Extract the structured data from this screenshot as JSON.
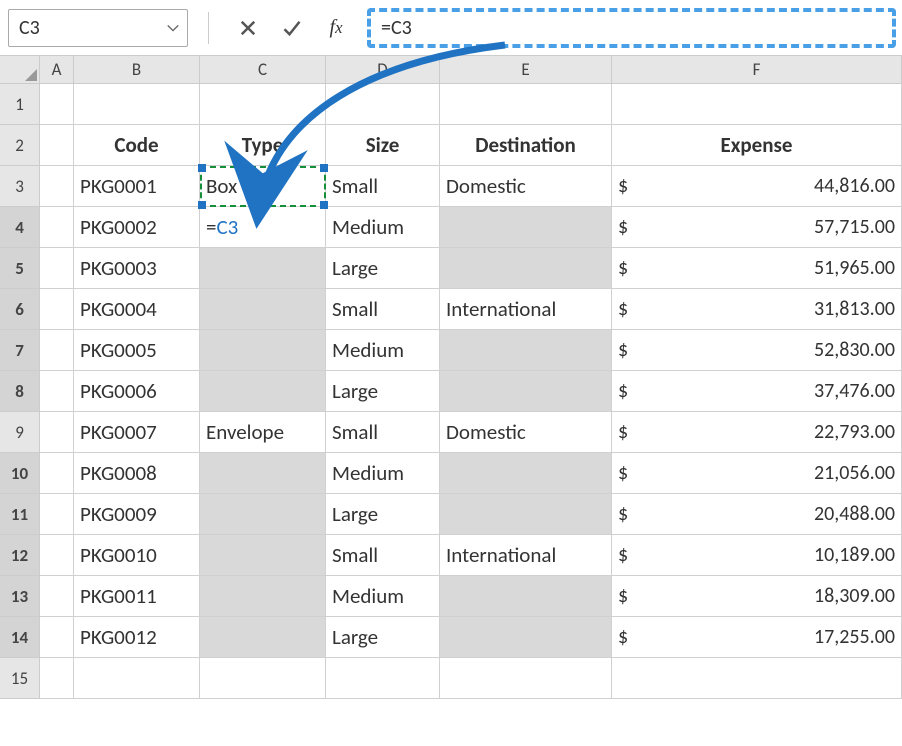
{
  "formula_bar": {
    "name_box": "C3",
    "formula": "=C3"
  },
  "columns": [
    "A",
    "B",
    "C",
    "D",
    "E",
    "F"
  ],
  "headers": {
    "B": "Code",
    "C": "Type",
    "D": "Size",
    "E": "Destination",
    "F": "Expense"
  },
  "active_cell": "C4",
  "referenced_cell": "C3",
  "formula_display": {
    "prefix": "=",
    "ref": "C3"
  },
  "rows": [
    {
      "n": 1
    },
    {
      "n": 2
    },
    {
      "n": 3,
      "code": "PKG0001",
      "type": "Box",
      "size": "Small",
      "dest": "Domestic",
      "expense": "44,816.00"
    },
    {
      "n": 4,
      "code": "PKG0002",
      "type_formula": true,
      "size": "Medium",
      "dest_gray": true,
      "expense": "57,715.00",
      "row_sel": true
    },
    {
      "n": 5,
      "code": "PKG0003",
      "type_gray": true,
      "size": "Large",
      "dest_gray": true,
      "expense": "51,965.00",
      "row_sel": true
    },
    {
      "n": 6,
      "code": "PKG0004",
      "type_gray": true,
      "size": "Small",
      "dest": "International",
      "expense": "31,813.00",
      "row_sel": true
    },
    {
      "n": 7,
      "code": "PKG0005",
      "type_gray": true,
      "size": "Medium",
      "dest_gray": true,
      "expense": "52,830.00",
      "row_sel": true
    },
    {
      "n": 8,
      "code": "PKG0006",
      "type_gray": true,
      "size": "Large",
      "dest_gray": true,
      "expense": "37,476.00",
      "row_sel": true
    },
    {
      "n": 9,
      "code": "PKG0007",
      "type": "Envelope",
      "size": "Small",
      "dest": "Domestic",
      "expense": "22,793.00"
    },
    {
      "n": 10,
      "code": "PKG0008",
      "type_gray": true,
      "size": "Medium",
      "dest_gray": true,
      "expense": "21,056.00",
      "row_sel": true
    },
    {
      "n": 11,
      "code": "PKG0009",
      "type_gray": true,
      "size": "Large",
      "dest_gray": true,
      "expense": "20,488.00",
      "row_sel": true
    },
    {
      "n": 12,
      "code": "PKG0010",
      "type_gray": true,
      "size": "Small",
      "dest": "International",
      "expense": "10,189.00",
      "row_sel": true
    },
    {
      "n": 13,
      "code": "PKG0011",
      "type_gray": true,
      "size": "Medium",
      "dest_gray": true,
      "expense": "18,309.00",
      "row_sel": true
    },
    {
      "n": 14,
      "code": "PKG0012",
      "type_gray": true,
      "size": "Large",
      "dest_gray": true,
      "expense": "17,255.00",
      "row_sel": true
    },
    {
      "n": 15
    }
  ],
  "currency": "$"
}
